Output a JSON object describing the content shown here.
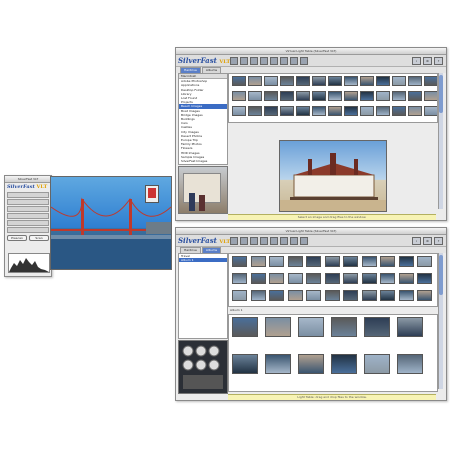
{
  "logo": {
    "brand": "SilverFast",
    "version": "VLT"
  },
  "prescan_window": {
    "title": "SilverFast VLT",
    "buttons": [
      "Prescan",
      "Scan"
    ]
  },
  "lighttable_top": {
    "title": "Virtual Light Table (SilverFast VLT)",
    "tabs": [
      "Hardrive",
      "Albums"
    ],
    "active_tab": "Hardrive",
    "drive": "Macintosh",
    "tree": [
      "Adobe Photoshop",
      "Applications",
      "Desktop Folder",
      "Library",
      "Lost Found",
      "Projects",
      "Beach Images",
      "Boat Images",
      "Bridge Images",
      "Buildings",
      "Cars",
      "Castles",
      "City Images",
      "Desert Photos",
      "Europe Trip",
      "Family Photos",
      "Flowers",
      "HDR Images",
      "Sample Images",
      "SilverFast Images",
      "Scans",
      "System Folder"
    ],
    "selected_tree_index": 6,
    "status": "Select an image and drag files to the window."
  },
  "lighttable_bottom": {
    "title": "Virtual Light Table (SilverFast VLT)",
    "tabs": [
      "Hardrive",
      "Albums"
    ],
    "active_tab": "Albums",
    "albums": [
      "Travel",
      "Album 1"
    ],
    "selected_album_index": 1,
    "album_header": "Album 1",
    "status": "Light Table: drag and drop files to the window."
  },
  "colors": {
    "accent": "#3b6cc4",
    "status_bg": "#f7f3b4",
    "window_bg": "#ececec"
  }
}
